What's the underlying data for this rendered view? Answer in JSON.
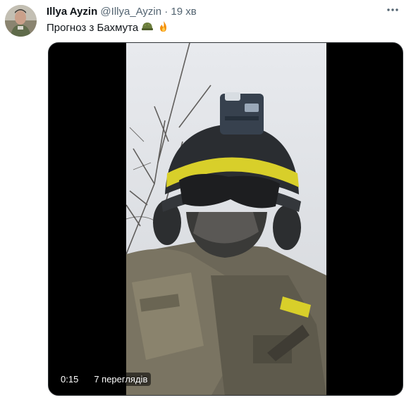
{
  "tweet": {
    "author_name": "Illya Ayzin",
    "author_handle": "@Illya_Ayzin",
    "separator": "·",
    "time": "19 хв",
    "more_icon": "ellipsis-icon",
    "text": "Прогноз з Бахмута",
    "emojis": [
      "helmet-emoji",
      "fire-emoji"
    ]
  },
  "video": {
    "duration": "0:15",
    "views": "7 переглядів"
  },
  "colors": {
    "text_primary": "#0f1419",
    "text_secondary": "#536471",
    "media_bg": "#000000",
    "sky": "#dfe2e6",
    "helmet": "#2a2d31",
    "band_yellow": "#d8cf2a",
    "uniform": "#6f6a5c"
  }
}
